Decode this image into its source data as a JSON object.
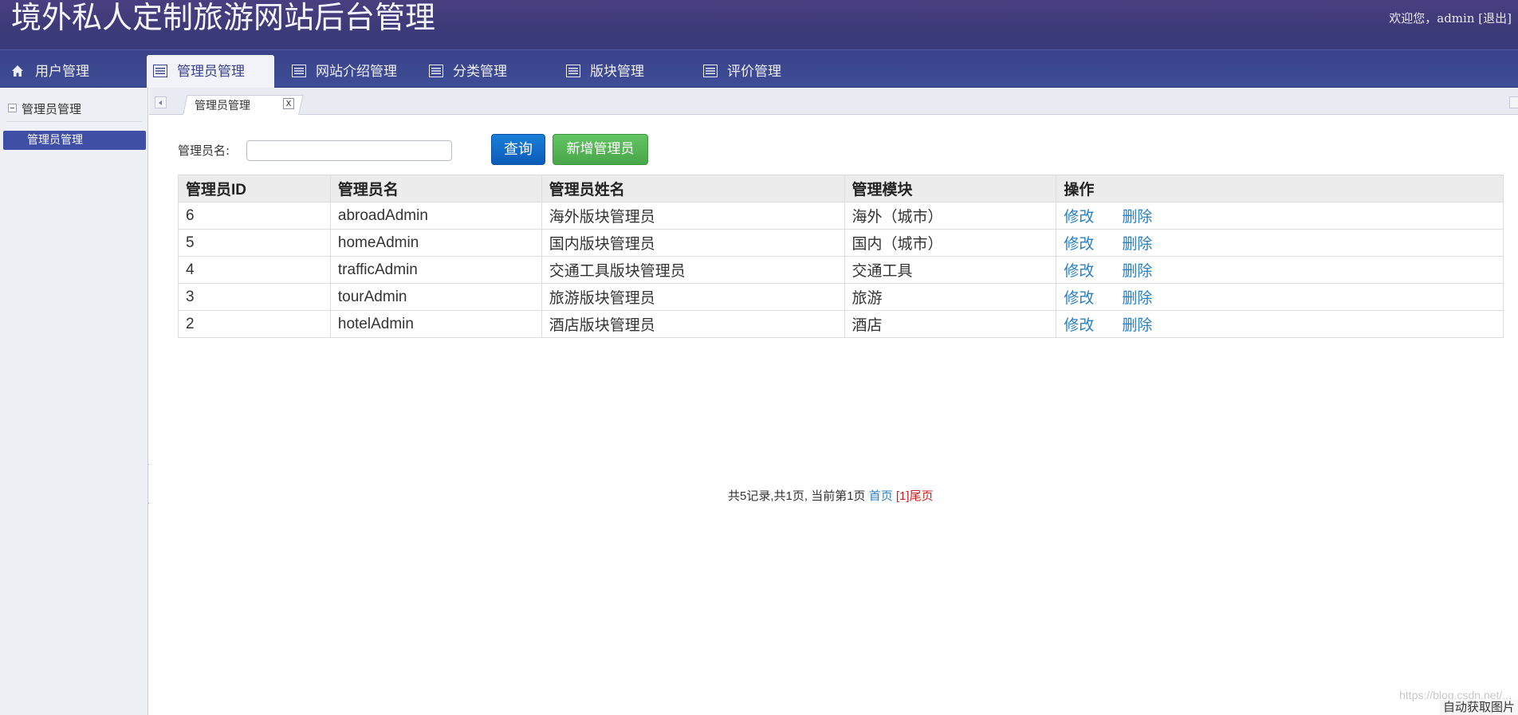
{
  "header": {
    "title": "境外私人定制旅游网站后台管理",
    "welcome": "欢迎您，admin",
    "logout": "[退出]"
  },
  "nav": {
    "items": [
      {
        "label": "用户管理",
        "icon": "home-icon",
        "active": false
      },
      {
        "label": "管理员管理",
        "icon": "list-icon",
        "active": true
      },
      {
        "label": "网站介绍管理",
        "icon": "list-icon",
        "active": false
      },
      {
        "label": "分类管理",
        "icon": "list-icon",
        "active": false
      },
      {
        "label": "版块管理",
        "icon": "list-icon",
        "active": false
      },
      {
        "label": "评价管理",
        "icon": "list-icon",
        "active": false
      }
    ]
  },
  "sidebar": {
    "header": "管理员管理",
    "items": [
      {
        "label": "管理员管理",
        "active": true
      }
    ]
  },
  "tabs": {
    "open": [
      {
        "label": "管理员管理",
        "close": "x"
      }
    ]
  },
  "search": {
    "label": "管理员名:",
    "value": "",
    "placeholder": "",
    "query_button": "查询",
    "add_button": "新增管理员"
  },
  "table": {
    "columns": [
      "管理员ID",
      "管理员名",
      "管理员姓名",
      "管理模块",
      "操作"
    ],
    "rows": [
      {
        "id": "6",
        "name": "abroadAdmin",
        "realname": "海外版块管理员",
        "module": "海外（城市）",
        "edit": "修改",
        "delete": "删除"
      },
      {
        "id": "5",
        "name": "homeAdmin",
        "realname": "国内版块管理员",
        "module": "国内（城市）",
        "edit": "修改",
        "delete": "删除"
      },
      {
        "id": "4",
        "name": "trafficAdmin",
        "realname": "交通工具版块管理员",
        "module": "交通工具",
        "edit": "修改",
        "delete": "删除"
      },
      {
        "id": "3",
        "name": "tourAdmin",
        "realname": "旅游版块管理员",
        "module": "旅游",
        "edit": "修改",
        "delete": "删除"
      },
      {
        "id": "2",
        "name": "hotelAdmin",
        "realname": "酒店版块管理员",
        "module": "酒店",
        "edit": "修改",
        "delete": "删除"
      }
    ]
  },
  "pager": {
    "summary": "共5记录,共1页, 当前第1页",
    "first": "首页",
    "current": "[1]",
    "last": "尾页"
  },
  "watermark": "https://blog.csdn.net/...",
  "auto_image": "自动获取图片",
  "colors": {
    "header_bg": "#3d3a78",
    "nav_bg": "#3e4e97",
    "accent": "#3f4fa6",
    "link": "#2a7fc2",
    "pager_red": "#cc1f1f",
    "query_btn": "#0b5bb8",
    "add_btn": "#4aa64a"
  }
}
